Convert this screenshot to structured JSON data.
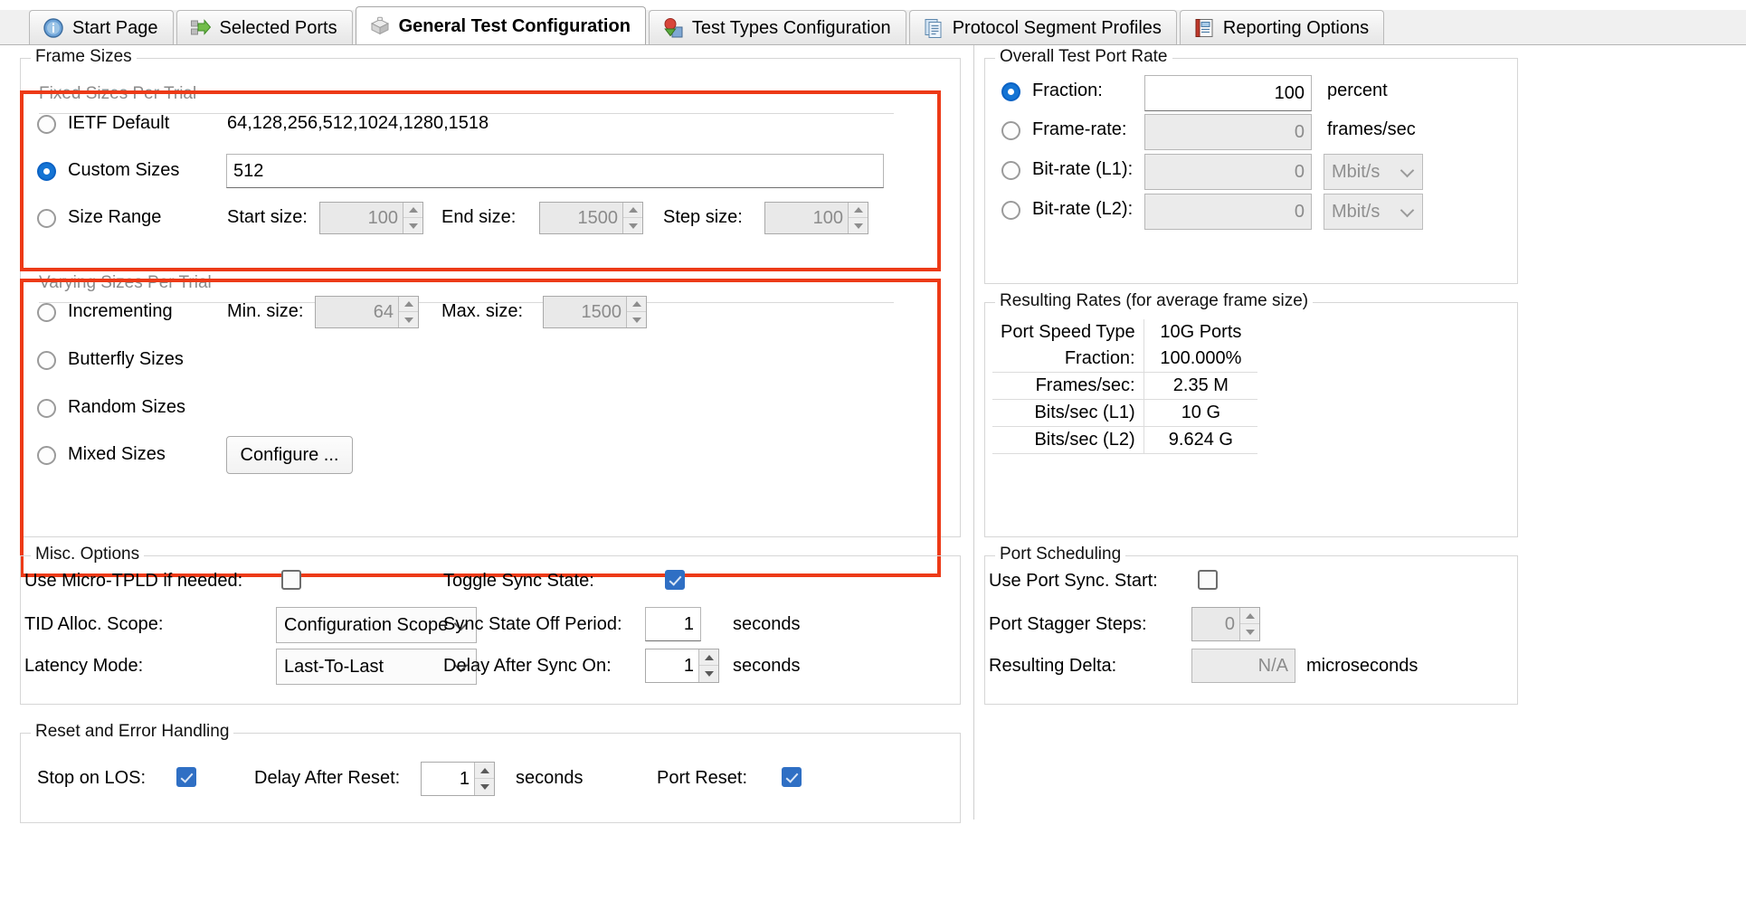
{
  "tabs": [
    {
      "label": "Start Page",
      "icon": "info-icon",
      "active": false
    },
    {
      "label": "Selected Ports",
      "icon": "ports-icon",
      "active": false
    },
    {
      "label": "General Test Configuration",
      "icon": "cube-icon",
      "active": true
    },
    {
      "label": "Test Types Configuration",
      "icon": "shapes-icon",
      "active": false
    },
    {
      "label": "Protocol Segment Profiles",
      "icon": "documents-icon",
      "active": false
    },
    {
      "label": "Reporting Options",
      "icon": "notebook-icon",
      "active": false
    }
  ],
  "colors": {
    "highlight": "#ed3a17",
    "accent": "#1474d4",
    "checkbox_checked": "#2f6fc4"
  },
  "frame_sizes": {
    "legend": "Frame Sizes",
    "fixed": {
      "subhead": "Fixed Sizes Per Trial",
      "ietf": {
        "label": "IETF Default",
        "selected": false,
        "value": "64,128,256,512,1024,1280,1518"
      },
      "custom": {
        "label": "Custom Sizes",
        "selected": true,
        "value": "512"
      },
      "size_range": {
        "label": "Size Range",
        "selected": false,
        "start": {
          "label": "Start size:",
          "value": "100"
        },
        "end": {
          "label": "End size:",
          "value": "1500"
        },
        "step": {
          "label": "Step size:",
          "value": "100"
        }
      }
    },
    "varying": {
      "subhead": "Varying Sizes Per Trial",
      "incrementing": {
        "label": "Incrementing",
        "selected": false,
        "min": {
          "label": "Min. size:",
          "value": "64"
        },
        "max": {
          "label": "Max. size:",
          "value": "1500"
        }
      },
      "butterfly": {
        "label": "Butterfly Sizes",
        "selected": false
      },
      "random": {
        "label": "Random Sizes",
        "selected": false
      },
      "mixed": {
        "label": "Mixed Sizes",
        "selected": false,
        "button": "Configure ..."
      }
    }
  },
  "port_rate": {
    "legend": "Overall Test Port Rate",
    "rows": [
      {
        "label": "Fraction:",
        "selected": true,
        "value": "100",
        "unit": "percent",
        "enabled": true,
        "has_combo": false
      },
      {
        "label": "Frame-rate:",
        "selected": false,
        "value": "0",
        "unit": "frames/sec",
        "enabled": false,
        "has_combo": false
      },
      {
        "label": "Bit-rate (L1):",
        "selected": false,
        "value": "0",
        "unit": "Mbit/s",
        "enabled": false,
        "has_combo": true
      },
      {
        "label": "Bit-rate (L2):",
        "selected": false,
        "value": "0",
        "unit": "Mbit/s",
        "enabled": false,
        "has_combo": true
      }
    ]
  },
  "resulting_rates": {
    "legend": "Resulting Rates (for average frame size)",
    "rows": [
      {
        "key": "Port Speed Type",
        "value": "10G Ports"
      },
      {
        "key": "Fraction:",
        "value": "100.000%"
      },
      {
        "key": "Frames/sec:",
        "value": "2.35 M"
      },
      {
        "key": "Bits/sec (L1)",
        "value": "10 G"
      },
      {
        "key": "Bits/sec (L2)",
        "value": "9.624 G"
      }
    ]
  },
  "misc_options": {
    "legend": "Misc. Options",
    "micro_tpld": {
      "label": "Use Micro-TPLD if needed:",
      "checked": false
    },
    "tid_alloc": {
      "label": "TID Alloc. Scope:",
      "value": "Configuration Scope"
    },
    "latency_mode": {
      "label": "Latency Mode:",
      "value": "Last-To-Last"
    },
    "toggle_sync": {
      "label": "Toggle Sync State:",
      "checked": true
    },
    "sync_off_period": {
      "label": "Sync State Off Period:",
      "value": "1",
      "unit": "seconds"
    },
    "delay_after_sync": {
      "label": "Delay After Sync On:",
      "value": "1",
      "unit": "seconds"
    }
  },
  "port_scheduling": {
    "legend": "Port Scheduling",
    "use_port_sync": {
      "label": "Use Port Sync. Start:",
      "checked": false
    },
    "stagger_steps": {
      "label": "Port Stagger Steps:",
      "value": "0"
    },
    "resulting_delta": {
      "label": "Resulting Delta:",
      "value": "N/A",
      "unit": "microseconds"
    }
  },
  "reset_error": {
    "legend": "Reset and Error Handling",
    "stop_on_los": {
      "label": "Stop on LOS:",
      "checked": true
    },
    "delay_after_reset": {
      "label": "Delay After Reset:",
      "value": "1",
      "unit": "seconds"
    },
    "port_reset": {
      "label": "Port Reset:",
      "checked": true
    }
  }
}
